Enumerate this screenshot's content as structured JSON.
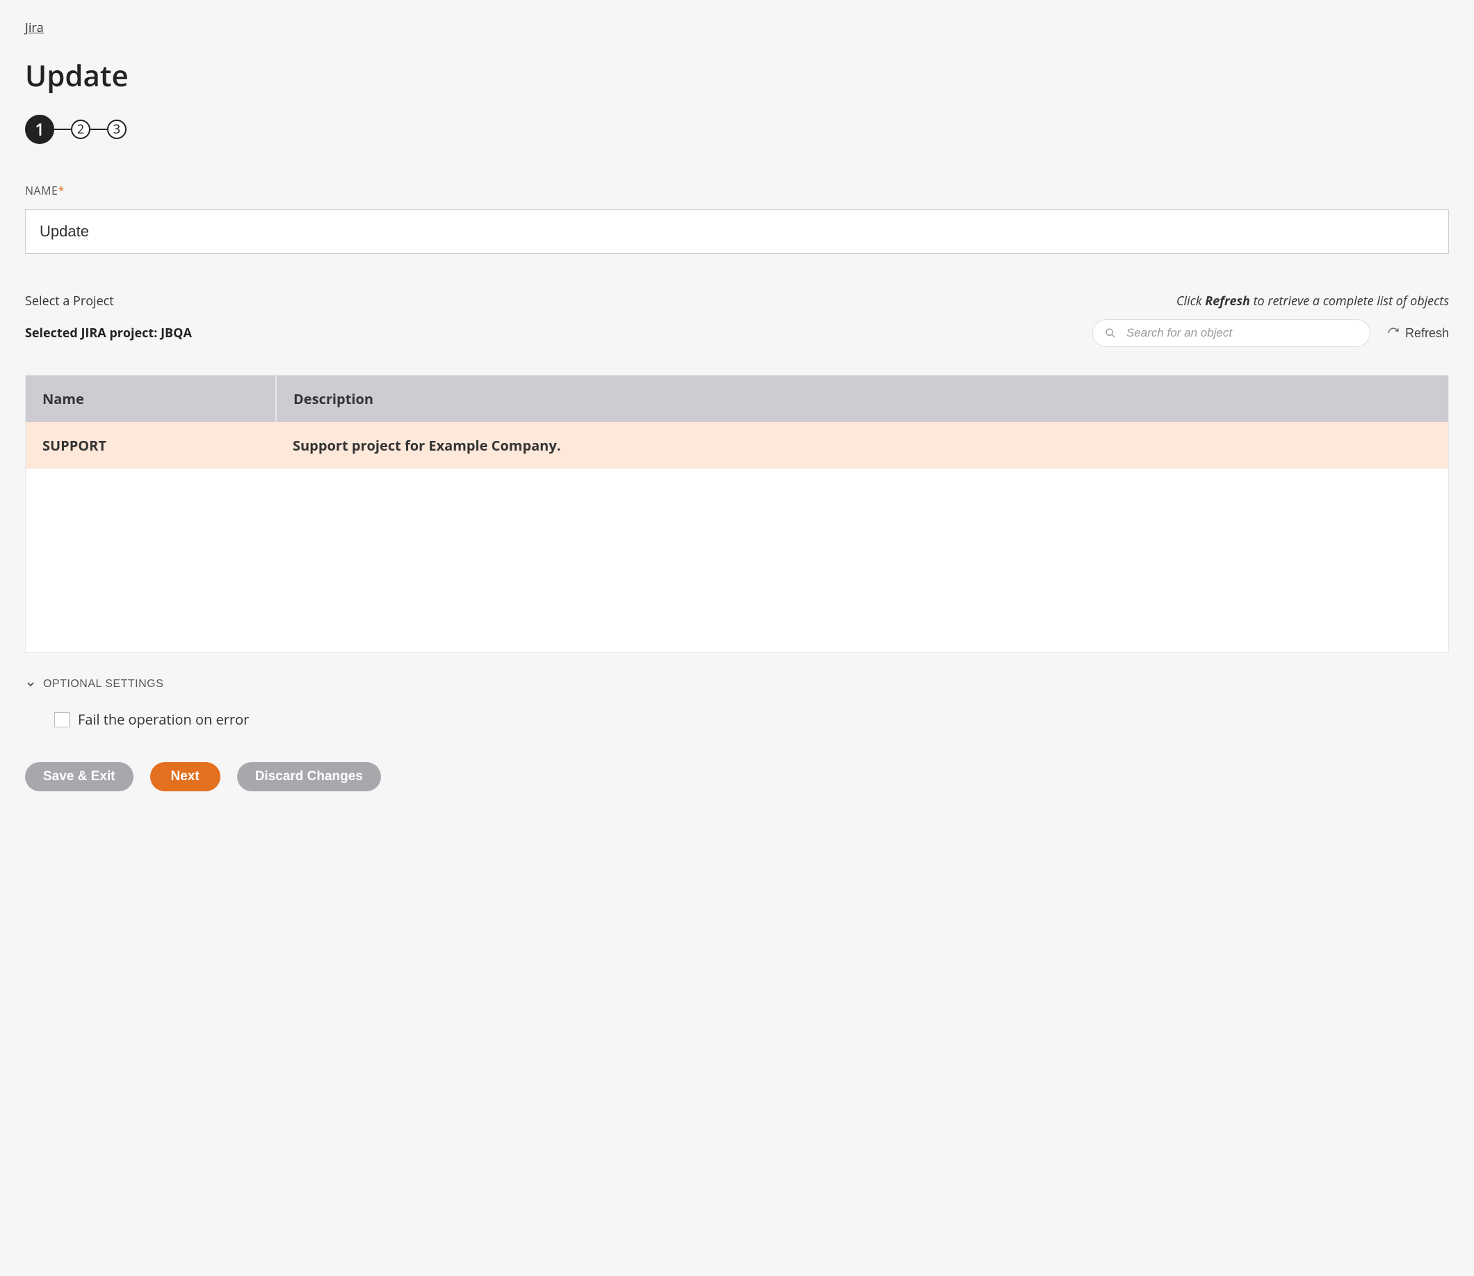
{
  "breadcrumb": "Jira",
  "page_title": "Update",
  "stepper": {
    "steps": [
      "1",
      "2",
      "3"
    ],
    "active_index": 0
  },
  "name_field": {
    "label": "NAME",
    "value": "Update"
  },
  "project": {
    "select_label": "Select a Project",
    "hint_prefix": "Click ",
    "hint_bold": "Refresh",
    "hint_suffix": " to retrieve a complete list of objects",
    "selected_prefix": "Selected JIRA project: ",
    "selected_value": "JBQA",
    "search_placeholder": "Search for an object",
    "refresh_label": "Refresh"
  },
  "table": {
    "headers": {
      "name": "Name",
      "description": "Description"
    },
    "rows": [
      {
        "name": "SUPPORT",
        "description": "Support project for Example Company.",
        "selected": true
      }
    ]
  },
  "optional": {
    "header": "OPTIONAL SETTINGS",
    "fail_on_error_label": "Fail the operation on error",
    "fail_on_error_checked": false
  },
  "buttons": {
    "save_exit": "Save & Exit",
    "next": "Next",
    "discard": "Discard Changes"
  },
  "colors": {
    "accent": "#e3701e",
    "table_header": "#cfcbd3",
    "row_selected": "#fde8da",
    "secondary_btn": "#a7a7ac"
  }
}
